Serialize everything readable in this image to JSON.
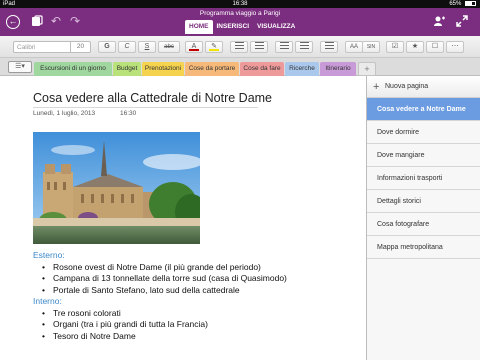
{
  "status_bar": {
    "device": "iPad",
    "time": "16:38",
    "battery": "65%"
  },
  "header": {
    "doc_title": "Programma viaggio a Parigi",
    "tabs": [
      {
        "label": "HOME",
        "active": true
      },
      {
        "label": "INSERISCI",
        "active": false
      },
      {
        "label": "VISUALIZZA",
        "active": false
      }
    ]
  },
  "toolbar": {
    "font_name": "Calibri",
    "font_size": "20",
    "bold": "G",
    "italic": "C",
    "underline": "S",
    "strikethrough": "abc",
    "font_color_letter": "A",
    "style_label": "AA",
    "style_small": "SIN",
    "font_color": "#c00000",
    "highlight_color": "#f2e600"
  },
  "sections": [
    {
      "label": "Escursioni di un giorno",
      "color": "#9fd79f"
    },
    {
      "label": "Budget",
      "color": "#b9e27a"
    },
    {
      "label": "Prenotazioni",
      "color": "#f5d34f"
    },
    {
      "label": "Cose da portare",
      "color": "#f6b97a"
    },
    {
      "label": "Cose da fare",
      "color": "#ef9a9a"
    },
    {
      "label": "Ricerche",
      "color": "#aac8ec"
    },
    {
      "label": "Itinerario",
      "color": "#c99ad8"
    }
  ],
  "page": {
    "title": "Cosa vedere alla Cattedrale di Notre Dame",
    "date": "Lunedì, 1 luglio, 2013",
    "time": "16:30",
    "outside_heading": "Esterno:",
    "outside_items": [
      "Rosone ovest di Notre Dame (il più grande del periodo)",
      "Campana di 13 tonnellate della torre sud (casa di Quasimodo)",
      "Portale di Santo Stefano, lato sud della cattedrale"
    ],
    "inside_heading": "Interno:",
    "inside_items": [
      "Tre rosoni colorati",
      "Organi (tra i più grandi di tutta la Francia)",
      "Tesoro di Notre Dame"
    ]
  },
  "pages_panel": {
    "new_page_label": "Nuova pagina",
    "items": [
      {
        "label": "Cosa vedere a Notre Dame",
        "active": true
      },
      {
        "label": "Dove dormire",
        "active": false
      },
      {
        "label": "Dove mangiare",
        "active": false
      },
      {
        "label": "Informazioni trasporti",
        "active": false
      },
      {
        "label": "Dettagli storici",
        "active": false
      },
      {
        "label": "Cosa fotografare",
        "active": false
      },
      {
        "label": "Mappa metropolitana",
        "active": false
      }
    ]
  }
}
